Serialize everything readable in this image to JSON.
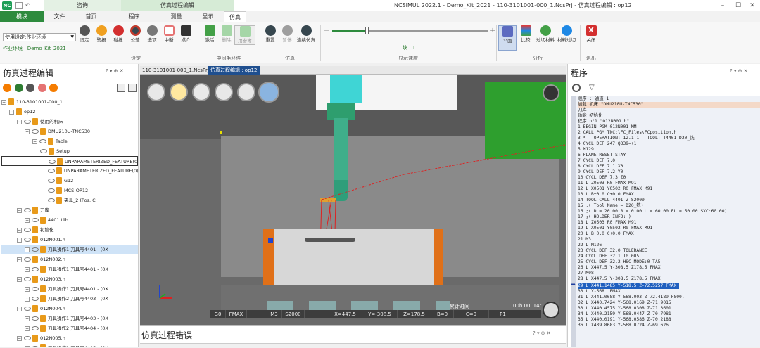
{
  "titlebar": {
    "app_logo": "NC",
    "context_tabs": [
      "咨询",
      "仿真过程编辑"
    ],
    "window_title": "NCSIMUL 2022.1 - Demo_Kit_2021 - 110-3101001-000_1.NcsPrj - 仿真过程编辑 : op12"
  },
  "tabs": [
    {
      "label": "模块"
    },
    {
      "label": "文件"
    },
    {
      "label": "首页"
    },
    {
      "label": "程序"
    },
    {
      "label": "测量"
    },
    {
      "label": "显示"
    },
    {
      "label": "仿真"
    }
  ],
  "ribbon": {
    "setup_select_value": "使用设定:作业环境",
    "env_label": "作业环境 : Demo_Kit_2021",
    "settings_group": {
      "label": "设定",
      "buttons": [
        {
          "label": "设定",
          "icon": "gear-icon",
          "color": "#555555"
        },
        {
          "label": "警报",
          "icon": "alert-icon",
          "color": "#f0a020"
        },
        {
          "label": "碰撞",
          "icon": "collision-icon",
          "color": "#d32f2f"
        },
        {
          "label": "公差",
          "icon": "tolerance-icon",
          "color": "#c0392b"
        },
        {
          "label": "选项",
          "icon": "options-icon",
          "color": "#666666"
        },
        {
          "label": "中断",
          "icon": "interrupt-icon",
          "color": "#e57373"
        },
        {
          "label": "媒介",
          "icon": "media-icon",
          "color": "#333333"
        }
      ]
    },
    "intermediate_group": {
      "label": "中间毛坯件",
      "buttons": [
        {
          "label": "激活",
          "icon": "activate-icon",
          "color": "#43a047"
        },
        {
          "label": "删除",
          "icon": "delete-icon",
          "color": "#a5d6a7"
        },
        {
          "label": "用参考",
          "icon": "reference-icon",
          "color": "#a5d6a7"
        }
      ]
    },
    "sim_group": {
      "label": "仿真",
      "buttons": [
        {
          "label": "重置",
          "icon": "reset-icon",
          "color": "#37474f"
        },
        {
          "label": "暂停",
          "icon": "pause-icon",
          "color": "#9e9e9e"
        },
        {
          "label": "连续仿真",
          "icon": "play-icon",
          "color": "#37474f"
        }
      ]
    },
    "speed_group": {
      "label": "显示速度",
      "minus": "−",
      "plus": "+",
      "speed_value": "块 : 1",
      "slider_fraction": 0.22
    },
    "analysis_group": {
      "label": "分析",
      "buttons": [
        {
          "label": "平面",
          "icon": "plane-icon",
          "color": "#5c6bc0"
        },
        {
          "label": "比较",
          "icon": "compare-icon",
          "color": "#e53935"
        },
        {
          "label": "过切材料",
          "icon": "overcut-icon",
          "color": "#43a047"
        },
        {
          "label": "材料过切",
          "icon": "material-icon",
          "color": "#1e88e5"
        }
      ]
    },
    "exit_group": {
      "label": "退出",
      "button": {
        "label": "关闭",
        "icon": "close-icon",
        "color": "#d32f2f",
        "glyph": "X"
      }
    }
  },
  "left_panel": {
    "title": "仿真过程编辑",
    "controls": "? ▾ ⊕ ✕",
    "tree": [
      {
        "indent": 0,
        "text": "110-3101001-000_1"
      },
      {
        "indent": 1,
        "text": "op12"
      },
      {
        "indent": 2,
        "text": "使用的机床"
      },
      {
        "indent": 3,
        "text": "DMU210U-TNC530"
      },
      {
        "indent": 4,
        "text": "Table"
      },
      {
        "indent": 5,
        "text": "Setup"
      },
      {
        "indent": 6,
        "text": "UNPARAMETERIZED_FEATURE(0) (Pos.)"
      },
      {
        "indent": 6,
        "text": "UNPARAMETERIZED_FEATURE(0) (Pos.)"
      },
      {
        "indent": 6,
        "text": "G12"
      },
      {
        "indent": 6,
        "text": "MCS-OP12"
      },
      {
        "indent": 6,
        "text": "夹具_2 (Pos. C"
      },
      {
        "indent": 2,
        "text": "刀库"
      },
      {
        "indent": 3,
        "text": "4401.tlib"
      },
      {
        "indent": 2,
        "text": "初始化"
      },
      {
        "indent": 2,
        "text": "012N001.h"
      },
      {
        "indent": 3,
        "text": "刀具操作1 刀具号4401 - (0X"
      },
      {
        "indent": 2,
        "text": "012N002.h"
      },
      {
        "indent": 3,
        "text": "刀具操作1 刀具号4401 - (0X"
      },
      {
        "indent": 2,
        "text": "012N003.h"
      },
      {
        "indent": 3,
        "text": "刀具操作1 刀具号4401 - (0X"
      },
      {
        "indent": 3,
        "text": "刀具操作2 刀具号4403 - (0X"
      },
      {
        "indent": 2,
        "text": "012N004.h"
      },
      {
        "indent": 3,
        "text": "刀具操作1 刀具号4403 - (0X"
      },
      {
        "indent": 3,
        "text": "刀具操作2 刀具号4404 - (0X"
      },
      {
        "indent": 2,
        "text": "012N005.h"
      },
      {
        "indent": 3,
        "text": "刀具操作1 刀具号4405 - (0X"
      }
    ]
  },
  "doc_tabs": [
    {
      "label": "110-3101001-000_1.NcsPrj"
    },
    {
      "label": "仿真过程编辑 : op12"
    }
  ],
  "viewport": {
    "status": {
      "mode": "G0",
      "feed": "FMAX",
      "spindle": "M3",
      "speed": "S2000",
      "x": "X=447.5",
      "y": "Y=-308.5",
      "z": "Z=178.5",
      "b": "B=0",
      "c": "C=0",
      "p": "P1"
    },
    "time_label": "累计时间",
    "time_value": "00h 00' 14\""
  },
  "bottom_panel": {
    "title": "仿真过程错误",
    "controls": "? ▾ ⊕ ✕"
  },
  "right_panel": {
    "title": "程序",
    "controls": "? ▾ ⊕ ✕",
    "current_line_index": 33,
    "lines": [
      "顺序 : 通道 1",
      "加载 机床 \"DMU210U-TNC530\"",
      "刀库",
      "功能 初始化",
      "程序 n°1 \"012N001.h\"",
      "1 BEGIN PGM 012N001 MM",
      "2 CALL PGM TNC:\\FC_Files\\FCposition.h",
      "3 * - OPERATION: 12.1.1 - TOOL: T4401 D20_铣",
      "4 CYCL DEF 247 Q339=+1",
      "5 M129",
      "6 PLANE RESET STAY",
      "7 CYCL DEF 7.0",
      "8 CYCL DEF 7.1 X0",
      "9 CYCL DEF 7.2 Y0",
      "10 CYCL DEF 7.3 Z0",
      "11 L Z0503 R0 FMAX M91",
      "12 L X0501 Y0502 R0 FMAX M91",
      "13 L B+0.0 C+0.0 FMAX",
      "14 TOOL CALL 4401 Z S2000",
      "15 ;( Tool Name = D20_铣)",
      "16 ;( D = 20.00 R = 0.00 L = 60.00 FL = 50.00 SXC:60.00)",
      "17 ;( HOLDER INFO:  )",
      "18 L Z0503 R0 FMAX M91",
      "19 L X0501 Y0502 R0 FMAX M91",
      "20 L B+0.0 C+0.0 FMAX",
      "21 M3",
      "22 L M126",
      "23 CYCL DEF 32.0 TOLERANCE",
      "24 CYCL DEF 32.1 T0.005",
      "25 CYCL DEF 32.2 HSC-MODE:0 TA5",
      "26 L X447.5 Y-308.5 Z178.5 FMAX",
      "27 M08",
      "28 L X447.5 Y-308.5 Z178.5 FMAX",
      "29 L X441.1485 Y-518.5 Z-72.5257 FMAX",
      "30 L Y-568. FMAX",
      "31 L X441.0688 Y-568.003 Z-72.4189 F800.",
      "32 L X440.7424 Y-568.0169 Z-71.9015",
      "33 L X440.4575 Y-568.0308 Z-71.3601",
      "34 L X440.2159 Y-568.0447 Z-70.7981",
      "35 L X440.0191 Y-568.0586 Z-70.2188",
      "36 L X439.8683 Y-568.0724 Z-69.626"
    ]
  }
}
